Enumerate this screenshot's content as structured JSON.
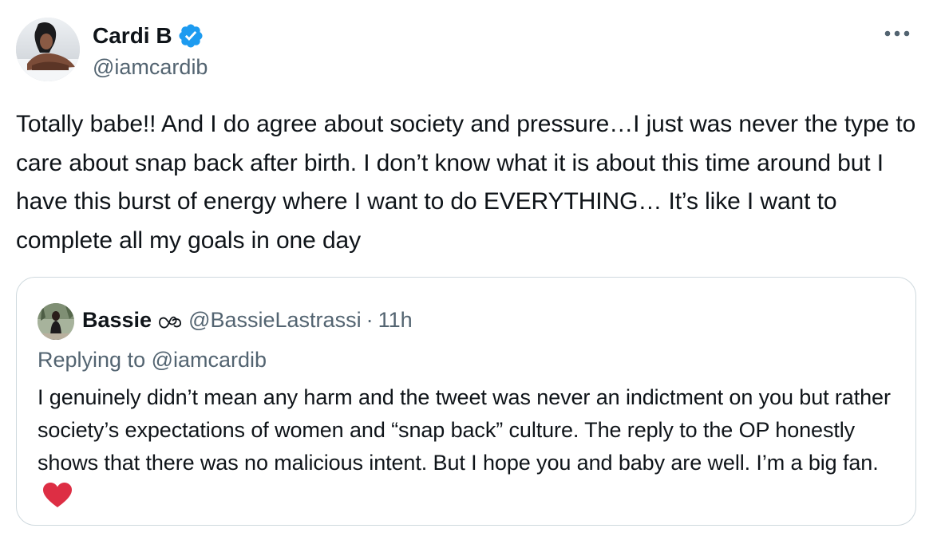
{
  "tweet": {
    "author": {
      "name": "Cardi B",
      "handle": "@iamcardib",
      "verified": true,
      "avatar_icon": "profile-photo"
    },
    "text": "Totally babe!! And I do agree about society and pressure…I just was never the type to care about snap back after birth. I don’t know what it is about this time around but I have this burst of energy where I want to do EVERYTHING… It’s like I want to complete all my goals in one day",
    "more_icon": "ellipsis-icon"
  },
  "quote": {
    "author": {
      "name": "Bassie",
      "badge_icon": "infinity-loop-icon",
      "handle": "@BassieLastrassi",
      "separator": "·",
      "time": "11h"
    },
    "replying_to_prefix": "Replying to ",
    "replying_to_handle": "@iamcardib",
    "text": "I genuinely didn’t mean any harm and the tweet was never an indictment on you but rather society’s expectations of women and “snap back” culture. The reply to the OP honestly shows that there was no malicious intent. But I hope you and baby are well. I’m a big fan.",
    "emoji": "red-heart"
  },
  "colors": {
    "text_primary": "#0f1419",
    "text_secondary": "#536471",
    "verified_blue": "#1d9bf0",
    "border": "#cfd9de",
    "heart_red": "#dd2e44"
  }
}
